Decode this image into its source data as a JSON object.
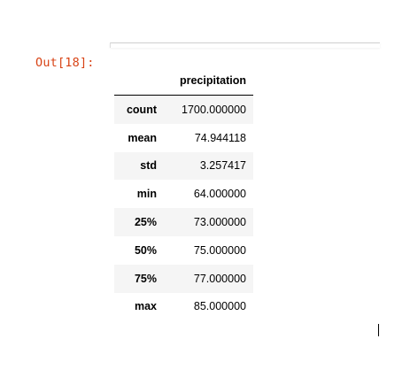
{
  "cell": {
    "prompt": "Out[18]:"
  },
  "table": {
    "column_header": "precipitation",
    "rows": [
      {
        "label": "count",
        "value": "1700.000000"
      },
      {
        "label": "mean",
        "value": "74.944118"
      },
      {
        "label": "std",
        "value": "3.257417"
      },
      {
        "label": "min",
        "value": "64.000000"
      },
      {
        "label": "25%",
        "value": "73.000000"
      },
      {
        "label": "50%",
        "value": "75.000000"
      },
      {
        "label": "75%",
        "value": "77.000000"
      },
      {
        "label": "max",
        "value": "85.000000"
      }
    ]
  },
  "colors": {
    "prompt": "#d84315",
    "stripe": "#f5f5f5"
  }
}
